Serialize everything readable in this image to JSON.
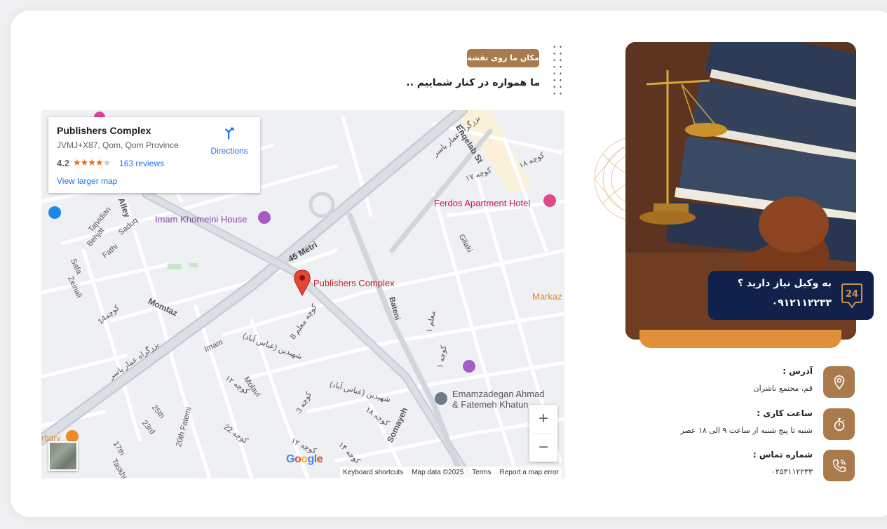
{
  "section": {
    "badge": "مکان ما روی نقشه",
    "subtitle": "ما همواره در کنار شماییم .."
  },
  "map": {
    "place_title": "Publishers Complex",
    "address": "JVMJ+X87, Qom, Qom Province",
    "rating": "4.2",
    "rating_value": 4.2,
    "reviews": "163 reviews",
    "directions": "Directions",
    "larger_map": "View larger map",
    "zoom_in": "+",
    "zoom_out": "−",
    "footer": {
      "shortcuts": "Keyboard shortcuts",
      "data": "Map data ©2025",
      "terms": "Terms",
      "report": "Report a map error"
    },
    "labels": {
      "enqelab": "Enqelab St",
      "ferdos": "Ferdos Apartment Hotel",
      "khomeini": "Imam Khomeini House",
      "metri": "45 Metri",
      "pin": "Publishers Complex",
      "markaz": "Markaz",
      "gilaki": "Gilaki",
      "alley": "Alley",
      "tajvidian": "Tajvidian",
      "behjat": "Behjat",
      "saduq": "Saduq",
      "fathi": "Fathi",
      "safa": "Safa",
      "zeinali": "Zeinali",
      "momtaz": "Momtaz",
      "koocheh14": "کوچه14",
      "imam": "Imam",
      "bateni": "Bateni",
      "emamzadegan1": "Emamzadegan Ahmad",
      "emamzadegan2": "& Fatemeh Khatun",
      "molavi": "Molavi",
      "st25": "25th",
      "st23": "23rd",
      "st17": "17th",
      "taskhiri": "Taskhi",
      "fatemi": "20th Fatemi",
      "somayeh": "Somayeh",
      "barbary": "rbary",
      "bozorgrah1": "بزرگراه عمار یاسر",
      "bozorgrah2": "بزرگراه عمار یاسر",
      "koocheh17": "کوچه ۱۷",
      "koocheh18a": "کوچه ۱۸",
      "koocheh8": "کوچه معلم 8",
      "shahidan1": "شهیدین (عباس آباد)",
      "shahidan2": "شهیدین (عباس آباد)",
      "koocheh12": "کوچه ۱۲",
      "koocheh3": "کوچه 3",
      "koocheh18b": "کوچه ۱۸",
      "koocheh22": "کوچه 22",
      "koocheh12b": "کوچه ۱۲",
      "koocheh14b": "کوچه ۱۴",
      "moalem1": "معلم ۱",
      "koocheh1": "کوچه ۱"
    }
  },
  "callbox": {
    "question": "به وکیل نیاز دارید ؟",
    "phone": "۰۹۱۲۱۱۲۲۳۳",
    "icon_text": "24"
  },
  "contact": [
    {
      "label": "آدرس :",
      "value": "قم، مجتمع ناشران",
      "icon": "location-pin-icon"
    },
    {
      "label": "ساعت کاری :",
      "value": "شنبه تا پنج شنبه از ساعت ۹ الی ۱۸ عصر",
      "icon": "stopwatch-icon"
    },
    {
      "label": "شماره تماس :",
      "value": "۰۲۵۳۱۱۲۲۳۳",
      "icon": "phone-icon"
    }
  ],
  "colors": {
    "brand_brown": "#a87a4c",
    "navy": "#122149",
    "orange": "#e08f3a"
  }
}
